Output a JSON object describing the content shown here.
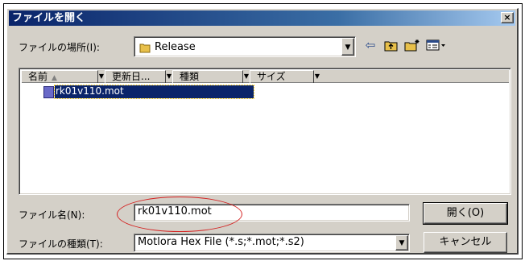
{
  "window": {
    "title": "ファイルを開く",
    "close_label": "×"
  },
  "look_in": {
    "label": "ファイルの場所(I):",
    "value": "Release"
  },
  "toolbar": {
    "back_icon": "⇦",
    "up_icon": "up-folder-icon",
    "new_folder_icon": "new-folder-icon",
    "view_menu_icon": "view-menu-icon"
  },
  "columns": [
    {
      "label": "名前"
    },
    {
      "label": "更新日..."
    },
    {
      "label": "種類"
    },
    {
      "label": "サイズ"
    }
  ],
  "files": [
    {
      "name": "rk01v110.mot",
      "selected": true
    }
  ],
  "file_name": {
    "label": "ファイル名(N):",
    "value": "rk01v110.mot"
  },
  "file_type": {
    "label": "ファイルの種類(T):",
    "value": "Motlora Hex File (*.s;*.mot;*.s2)"
  },
  "buttons": {
    "open": "開く(O)",
    "cancel": "キャンセル"
  },
  "colors": {
    "title_start": "#0a246a",
    "title_end": "#a6caf0",
    "selection": "#0a246a",
    "annotation": "#d42020",
    "face": "#d4d0c8"
  }
}
